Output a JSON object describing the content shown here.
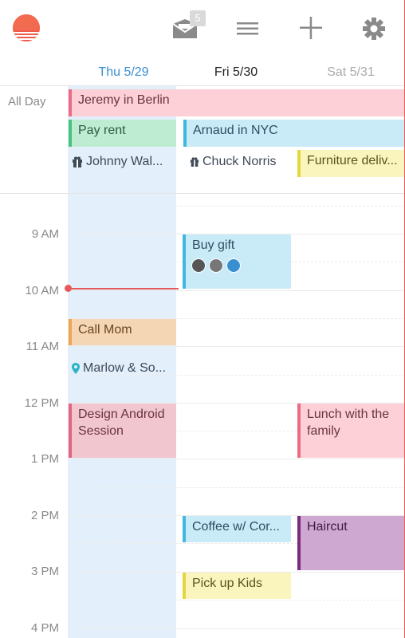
{
  "app": {
    "name": "Sunrise Calendar"
  },
  "toolbar": {
    "inbox_count": "5",
    "icons": [
      "sunrise-logo",
      "inbox-icon",
      "menu-icon",
      "add-icon",
      "gear-icon"
    ]
  },
  "days": [
    {
      "label": "Thu 5/29",
      "state": "today",
      "color": "#3a8fd1"
    },
    {
      "label": "Fri 5/30",
      "state": "normal",
      "color": "#222222"
    },
    {
      "label": "Sat 5/31",
      "state": "weekend",
      "color": "#aaaaaa"
    }
  ],
  "allday": {
    "label": "All Day",
    "events": [
      {
        "title": "Jeremy in Berlin",
        "color": "#fcd0d6",
        "accent": "#ec6a84"
      },
      {
        "title": "Pay rent",
        "color": "#bdecd2",
        "accent": "#48c281"
      },
      {
        "title": "Arnaud in NYC",
        "color": "#c9ebf7",
        "accent": "#41b7de"
      },
      {
        "title": "Furniture deliv...",
        "color": "#f9f5bd",
        "accent": "#e4d73e"
      }
    ],
    "birthdays": [
      {
        "title": "Johnny Wal...",
        "icon": "gift-icon"
      },
      {
        "title": "Chuck Norris",
        "icon": "gift-icon"
      }
    ]
  },
  "hours": [
    "9 AM",
    "10 AM",
    "11 AM",
    "12 PM",
    "1 PM",
    "2 PM",
    "3 PM",
    "4 PM"
  ],
  "events": [
    {
      "title": "Buy gift",
      "color": "#c9ebf7",
      "accent": "#41b7de"
    },
    {
      "title": "Call Mom",
      "color": "#f5d6b4",
      "accent": "#f0a54f"
    },
    {
      "title": "Marlow & So...",
      "icon": "location-pin-icon"
    },
    {
      "title": "Design Android Session",
      "color": "#f1c6cf",
      "accent": "#e0667d"
    },
    {
      "title": "Lunch with the family",
      "color": "#fcd0d6",
      "accent": "#ec6a84"
    },
    {
      "title": "Coffee w/ Cor...",
      "color": "#c9ebf7",
      "accent": "#41b7de"
    },
    {
      "title": "Haircut",
      "color": "#cfa8d1",
      "accent": "#7a2b7e"
    },
    {
      "title": "Pick up Kids",
      "color": "#f9f5bd",
      "accent": "#e4d73e"
    }
  ]
}
